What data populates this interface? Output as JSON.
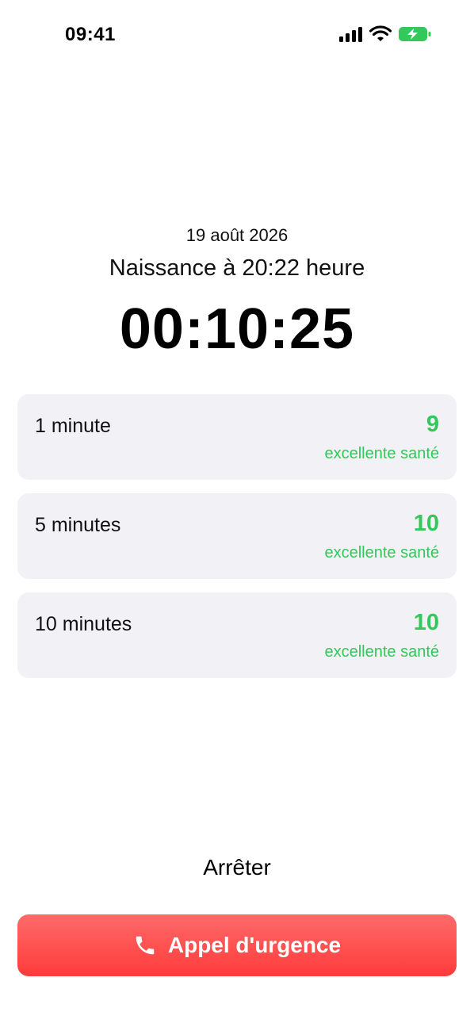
{
  "status_bar": {
    "time": "09:41",
    "icons": [
      "cellular-signal-icon",
      "wifi-icon",
      "battery-charging-icon"
    ],
    "battery_color": "#34c759"
  },
  "header": {
    "date": "19 août 2026",
    "birth_label": "Naissance à 20:22 heure",
    "timer": "00:10:25"
  },
  "scores": [
    {
      "label": "1 minute",
      "score": "9",
      "status": "excellente santé"
    },
    {
      "label": "5 minutes",
      "score": "10",
      "status": "excellente santé"
    },
    {
      "label": "10 minutes",
      "score": "10",
      "status": "excellente santé"
    }
  ],
  "actions": {
    "stop_label": "Arrêter",
    "emergency_label": "Appel d'urgence",
    "emergency_icon": "phone-icon"
  },
  "colors": {
    "accent_green": "#34c759",
    "danger_red": "#ff3b3b",
    "card_bg": "#f1f1f6"
  }
}
